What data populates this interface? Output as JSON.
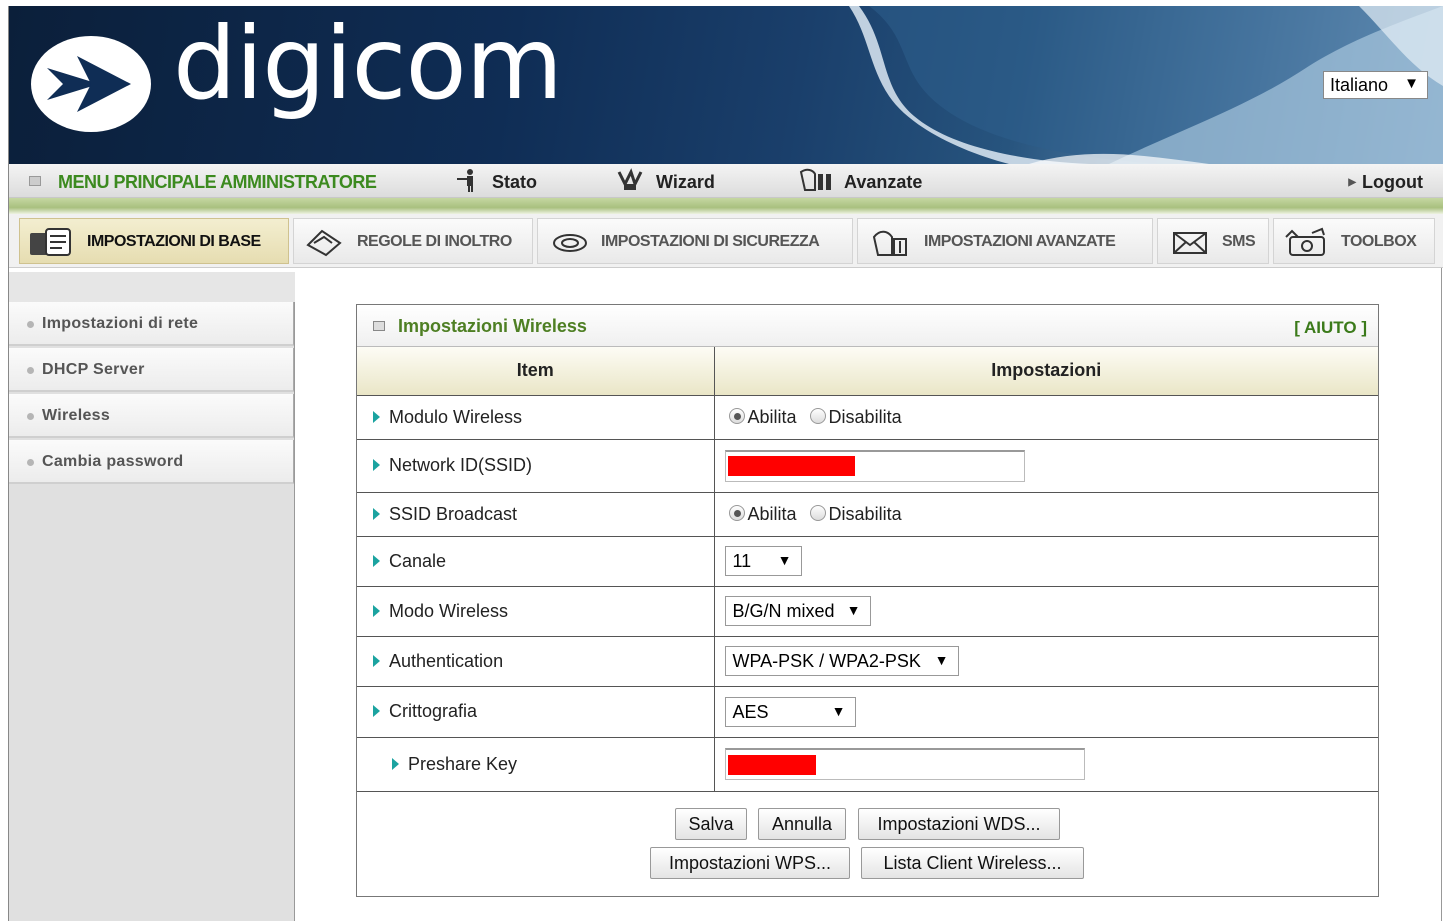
{
  "brand": {
    "logo_text": "digicom"
  },
  "language": {
    "selected": "Italiano"
  },
  "main_menu": {
    "title": "MENU PRINCIPALE AMMINISTRATORE",
    "items": [
      {
        "label": "Stato",
        "icon": "status-person-icon"
      },
      {
        "label": "Wizard",
        "icon": "wizard-icon"
      },
      {
        "label": "Avanzate",
        "icon": "advanced-icon"
      }
    ],
    "logout": "Logout"
  },
  "sub_tabs": [
    {
      "label": "IMPOSTAZIONI DI BASE",
      "icon": "base-settings-icon",
      "active": true
    },
    {
      "label": "REGOLE DI INOLTRO",
      "icon": "forwarding-icon",
      "active": false
    },
    {
      "label": "IMPOSTAZIONI DI SICUREZZA",
      "icon": "security-icon",
      "active": false
    },
    {
      "label": "IMPOSTAZIONI AVANZATE",
      "icon": "advanced-settings-icon",
      "active": false
    },
    {
      "label": "SMS",
      "icon": "mail-icon",
      "active": false
    },
    {
      "label": "TOOLBOX",
      "icon": "toolbox-icon",
      "active": false
    }
  ],
  "sidebar": {
    "items": [
      {
        "label": "Impostazioni di rete"
      },
      {
        "label": "DHCP Server"
      },
      {
        "label": "Wireless"
      },
      {
        "label": "Cambia password"
      }
    ]
  },
  "panel": {
    "title": "Impostazioni Wireless",
    "help": "[ AIUTO ]",
    "columns": {
      "item": "Item",
      "settings": "Impostazioni"
    },
    "rows": {
      "wireless_module": {
        "label": "Modulo Wireless",
        "enable": "Abilita",
        "disable": "Disabilita",
        "value": "Abilita"
      },
      "ssid": {
        "label": "Network ID(SSID)"
      },
      "ssid_broadcast": {
        "label": "SSID Broadcast",
        "enable": "Abilita",
        "disable": "Disabilita",
        "value": "Abilita"
      },
      "channel": {
        "label": "Canale",
        "value": "11"
      },
      "wireless_mode": {
        "label": "Modo Wireless",
        "value": "B/G/N mixed"
      },
      "authentication": {
        "label": "Authentication",
        "value": "WPA-PSK / WPA2-PSK"
      },
      "encryption": {
        "label": "Crittografia",
        "value": "AES"
      },
      "preshare_key": {
        "label": "Preshare Key"
      }
    },
    "buttons": {
      "save": "Salva",
      "cancel": "Annulla",
      "wds": "Impostazioni WDS...",
      "wps": "Impostazioni WPS...",
      "client_list": "Lista Client Wireless..."
    }
  },
  "colors": {
    "accent_green": "#3c8a1f",
    "redacted": "#ff0000",
    "row_marker": "#1ba3a0"
  }
}
